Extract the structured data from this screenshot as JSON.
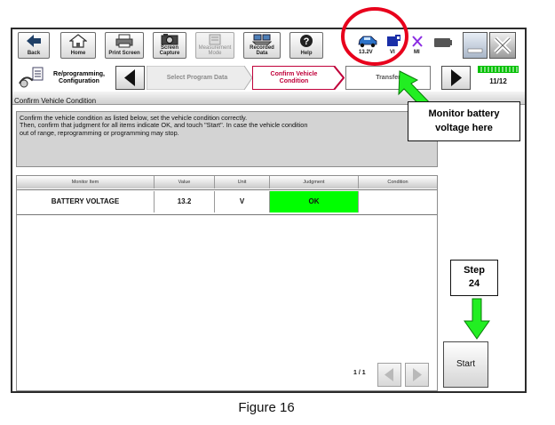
{
  "toolbar": {
    "back": "Back",
    "home": "Home",
    "print_screen": "Print Screen",
    "screen_capture_1": "Screen",
    "screen_capture_2": "Capture",
    "measurement_1": "Measurement",
    "measurement_2": "Mode",
    "recorded_1": "Recorded",
    "recorded_2": "Data",
    "help": "Help"
  },
  "status": {
    "battery_voltage": "13.2V",
    "vi": "VI",
    "mi": "MI"
  },
  "nav": {
    "reprogramming_1": "Re/programming,",
    "reprogramming_2": "Configuration",
    "select_program_data": "Select Program Data",
    "confirm_vehicle_1": "Confirm Vehicle",
    "confirm_vehicle_2": "Condition",
    "next_step_partial": "Transfer",
    "step_counter": "11/12"
  },
  "section_title": "Confirm Vehicle Condition",
  "message": {
    "line1": "Confirm the vehicle condition as listed below, set the vehicle condition correctly.",
    "line2": "Then, confirm that judgment for all items indicate OK, and touch \"Start\". In case the vehicle condition",
    "line3": "out of range, reprogramming or programming may stop."
  },
  "table": {
    "headers": [
      "Monitor Item",
      "Value",
      "Unit",
      "Judgment",
      "Condition"
    ],
    "rows": [
      {
        "monitor_item": "BATTERY VOLTAGE",
        "value": "13.2",
        "unit": "V",
        "judgment": "OK",
        "condition": ""
      }
    ]
  },
  "pager": {
    "page": "1 / 1"
  },
  "start_label": "Start",
  "annotations": {
    "monitor_1": "Monitor battery",
    "monitor_2": "voltage here",
    "step_1": "Step",
    "step_2": "24",
    "figure": "Figure 16"
  },
  "colors": {
    "ok_green": "#00ff00",
    "arrow_green": "#22ee22",
    "highlight_red": "#e8001c",
    "active_tab": "#c0003a",
    "battery_indicator": "#00c000"
  }
}
